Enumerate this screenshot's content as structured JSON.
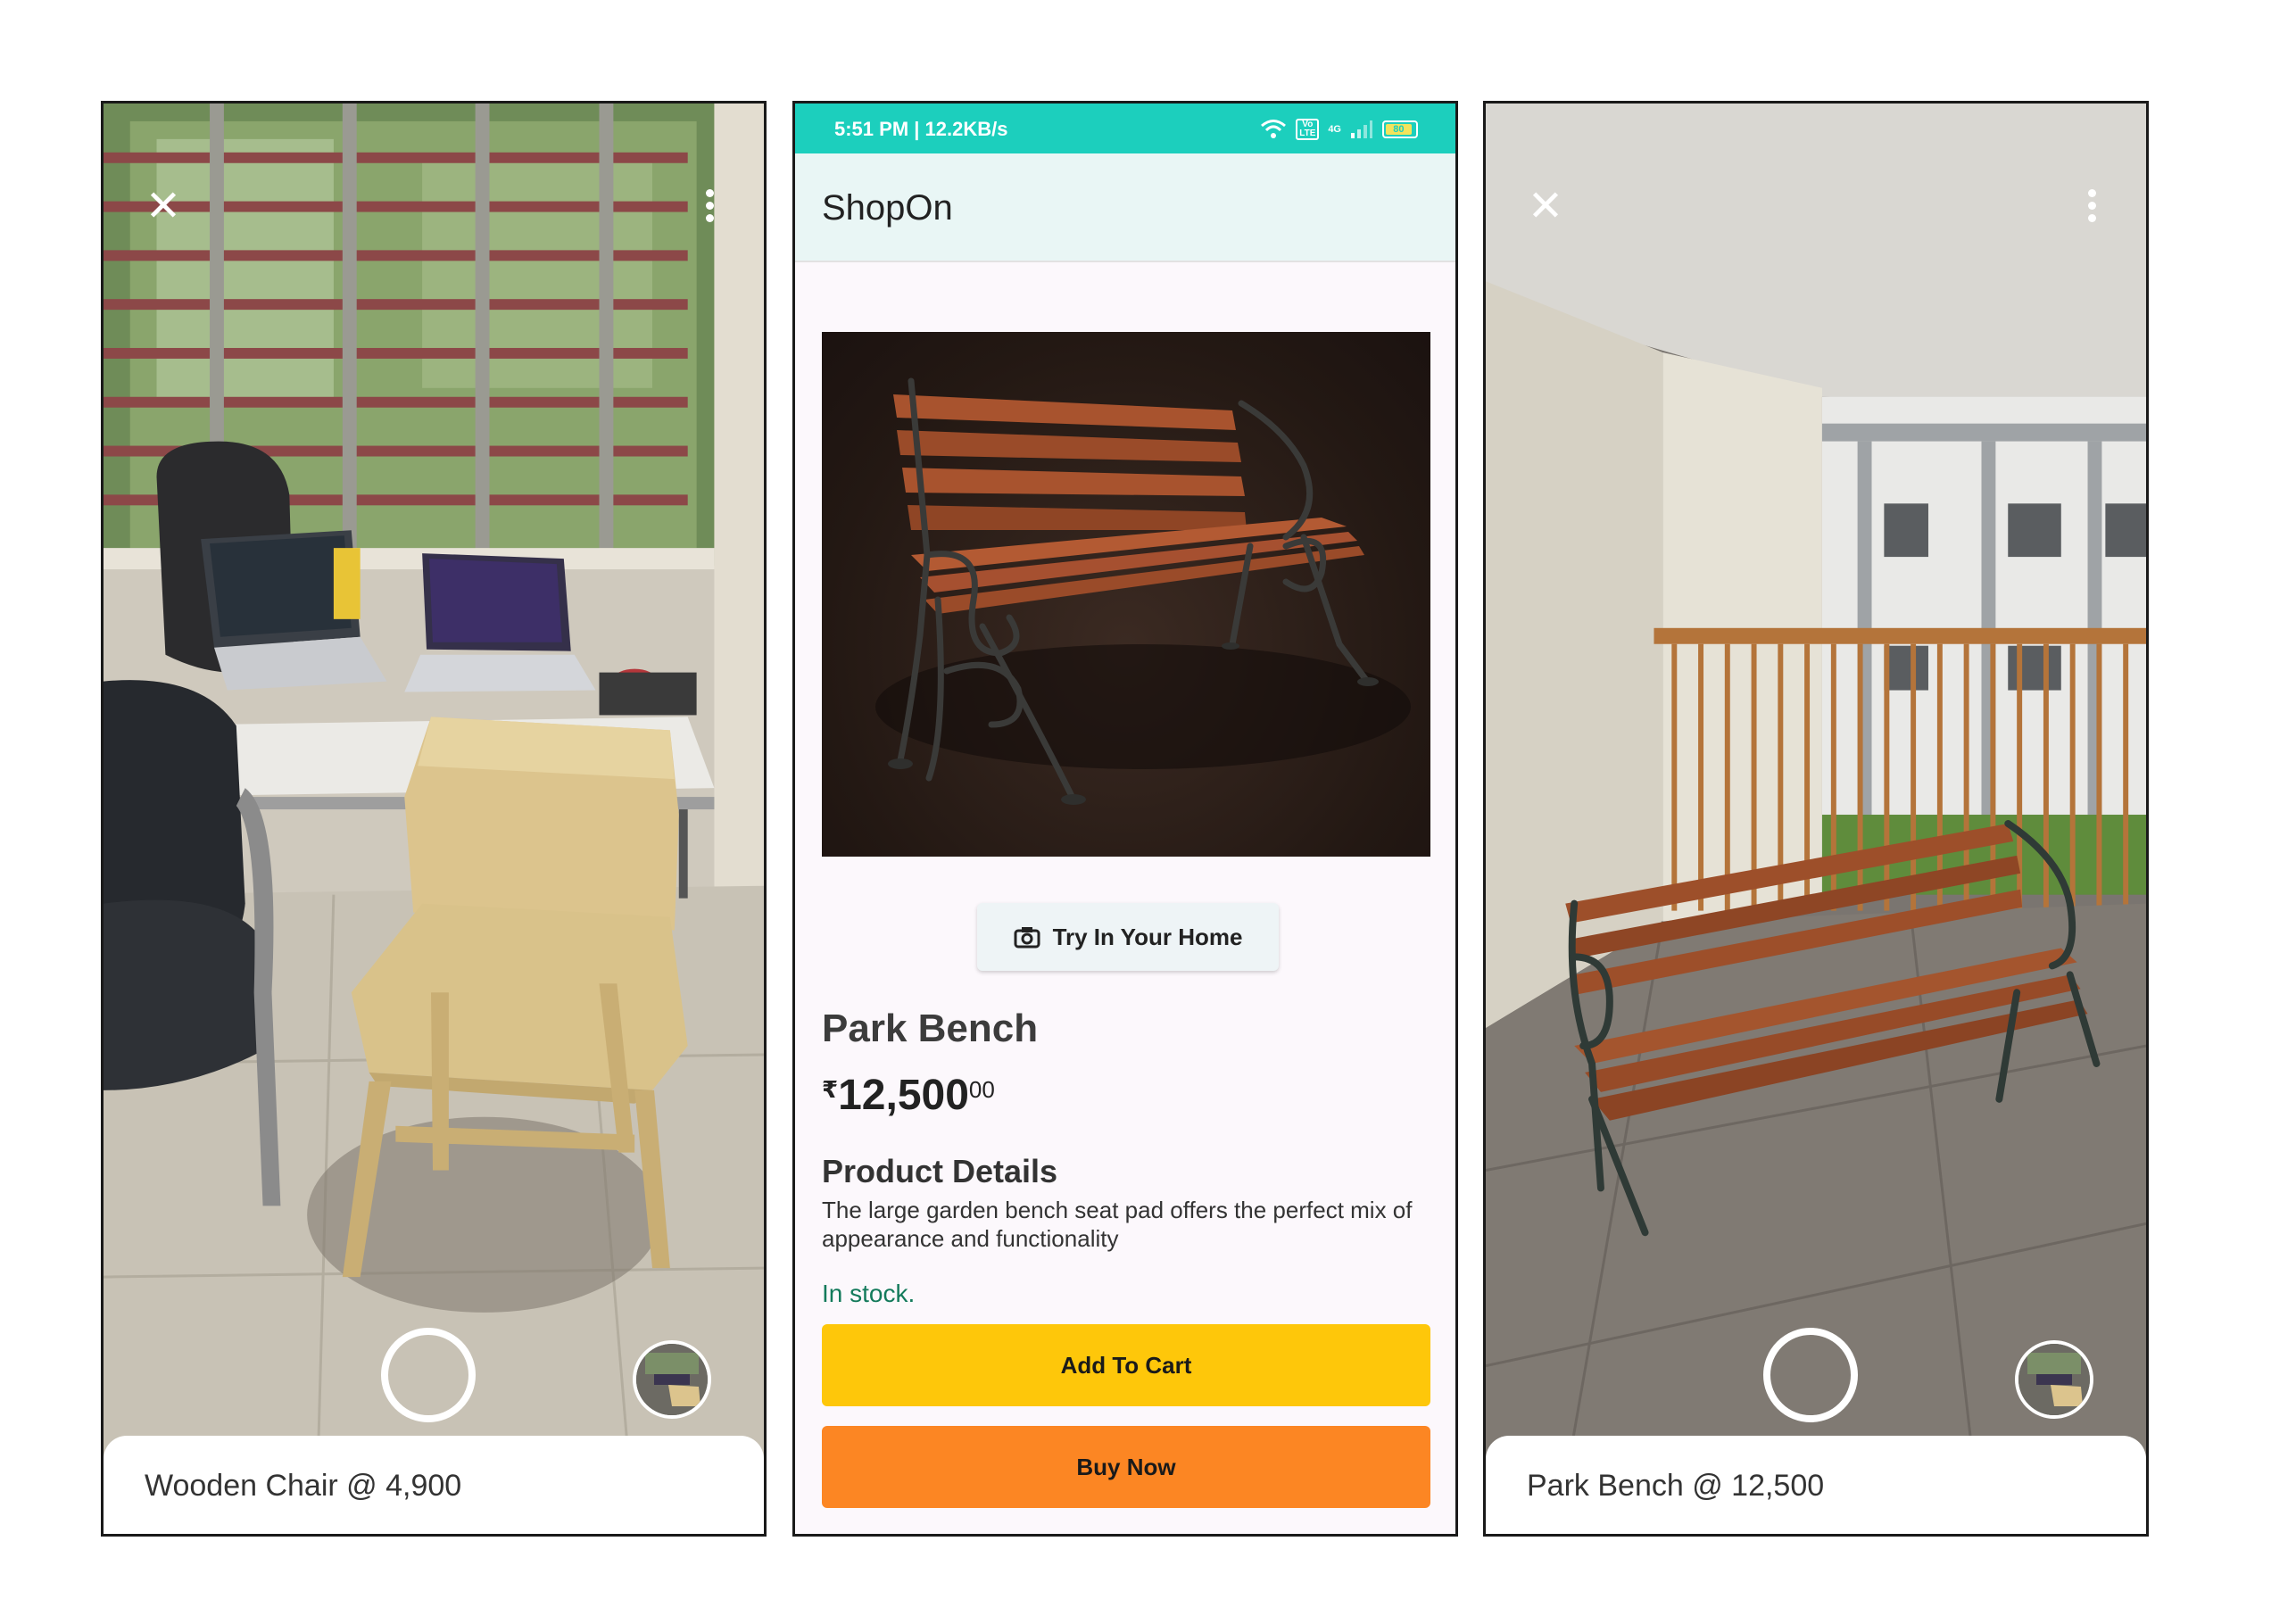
{
  "left_screen": {
    "caption": "Wooden Chair @ 4,900",
    "close_icon": "close-icon",
    "menu_icon": "more-vert-icon"
  },
  "shop_screen": {
    "status_bar": {
      "time_speed": "5:51 PM | 12.2KB/s",
      "network": "4G",
      "volte": "Vo LTE",
      "battery": "80"
    },
    "app_title": "ShopOn",
    "try_home_label": "Try In Your Home",
    "product_name": "Park Bench",
    "price": {
      "symbol": "₹",
      "main": "12,500",
      "fraction": "00"
    },
    "details_heading": "Product Details",
    "details_text": "The large garden bench seat pad offers the perfect mix of appearance and functionality",
    "stock_status": "In stock.",
    "add_to_cart_label": "Add To Cart",
    "buy_now_label": "Buy Now",
    "colors": {
      "status_bar": "#1ccfbd",
      "add_to_cart": "#fec70a",
      "buy_now": "#fc8623",
      "stock": "#137a5b"
    }
  },
  "right_screen": {
    "caption": "Park Bench @ 12,500",
    "close_icon": "close-icon",
    "menu_icon": "more-vert-icon"
  }
}
